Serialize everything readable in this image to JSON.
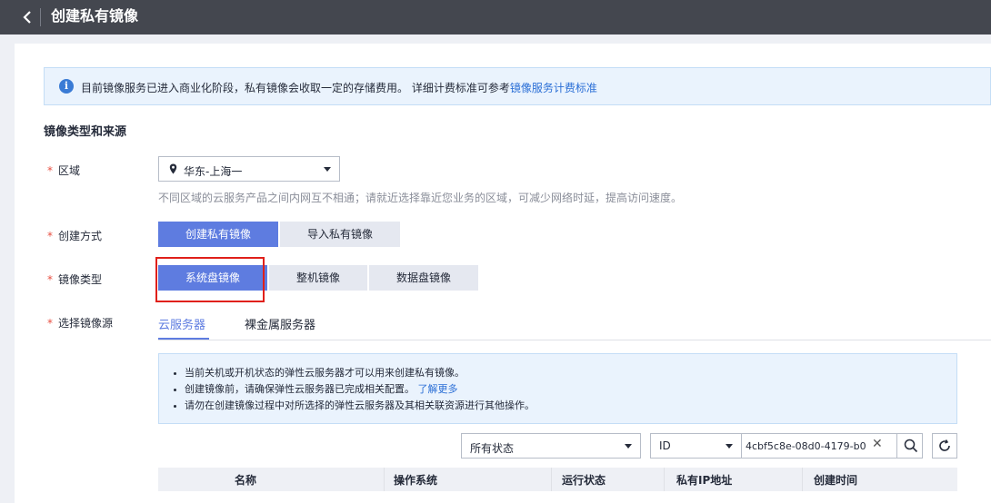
{
  "header": {
    "title": "创建私有镜像",
    "back_icon": "chevron-left-icon"
  },
  "notice": {
    "icon": "info-icon",
    "text": "目前镜像服务已进入商业化阶段，私有镜像会收取一定的存储费用。 详细计费标准可参考",
    "link": "镜像服务计费标准"
  },
  "section": {
    "title": "镜像类型和来源"
  },
  "region": {
    "label": "区域",
    "value": "华东-上海一",
    "hint": "不同区域的云服务产品之间内网互不相通；请就近选择靠近您业务的区域，可减少网络时延，提高访问速度。"
  },
  "create_method": {
    "label": "创建方式",
    "options": [
      "创建私有镜像",
      "导入私有镜像"
    ],
    "selected": "创建私有镜像"
  },
  "image_type": {
    "label": "镜像类型",
    "options": [
      "系统盘镜像",
      "整机镜像",
      "数据盘镜像"
    ],
    "selected": "系统盘镜像"
  },
  "image_source": {
    "label": "选择镜像源",
    "tabs": [
      "云服务器",
      "裸金属服务器"
    ],
    "selected_tab": "云服务器"
  },
  "tips": {
    "items": [
      "当前关机或开机状态的弹性云服务器才可以用来创建私有镜像。",
      "创建镜像前，请确保弹性云服务器已完成相关配置。",
      "请勿在创建镜像过程中对所选择的弹性云服务器及其相关联资源进行其他操作。"
    ],
    "link": "了解更多"
  },
  "filter": {
    "status_value": "所有状态",
    "field_value": "ID",
    "search_value": "4cbf5c8e-08d0-4179-b0"
  },
  "table": {
    "columns": [
      "名称",
      "操作系统",
      "运行状态",
      "私有IP地址",
      "创建时间"
    ]
  },
  "colors": {
    "accent": "#5e7ce0",
    "topbar": "#44474f",
    "highlight": "#e0201a"
  }
}
